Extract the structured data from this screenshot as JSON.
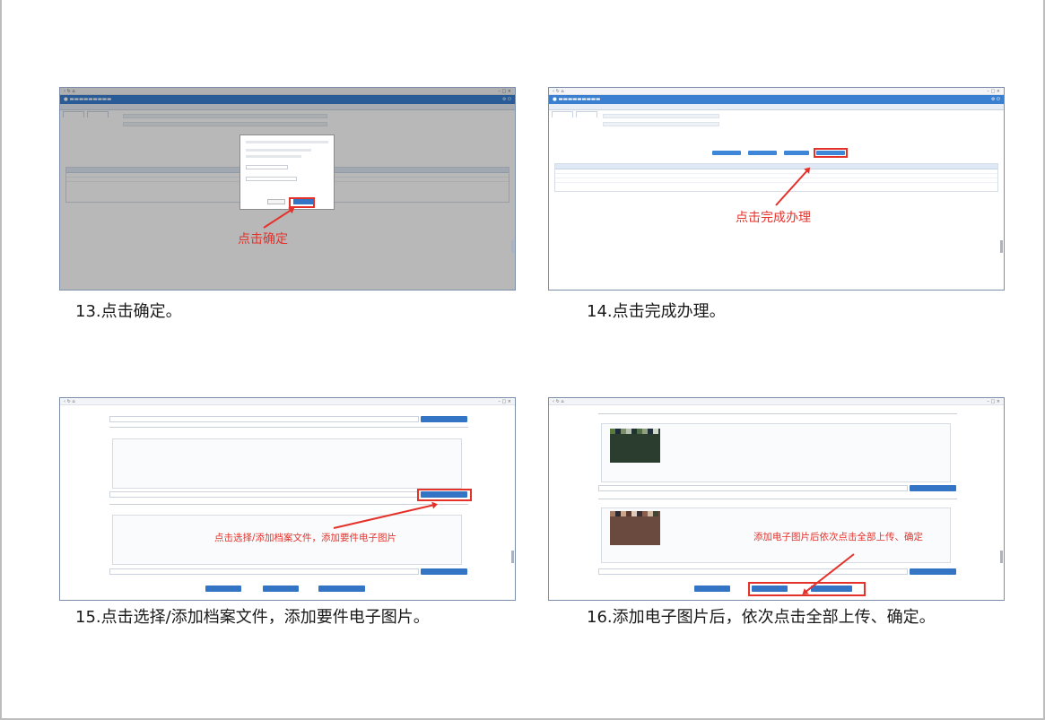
{
  "steps": [
    {
      "caption": "13.点击确定。",
      "note": "点击确定"
    },
    {
      "caption": "14.点击完成办理。",
      "note": "点击完成办理"
    },
    {
      "caption": "15.点击选择/添加档案文件，添加要件电子图片。",
      "note": "点击选择/添加档案文件，添加要件电子图片"
    },
    {
      "caption": "16.添加电子图片后，依次点击全部上传、确定。",
      "note": "添加电子图片后依次点击全部上传、确定"
    }
  ],
  "colors": {
    "accent": "#e4322b",
    "app_blue": "#3a7fd0",
    "button_blue": "#3474c4"
  }
}
